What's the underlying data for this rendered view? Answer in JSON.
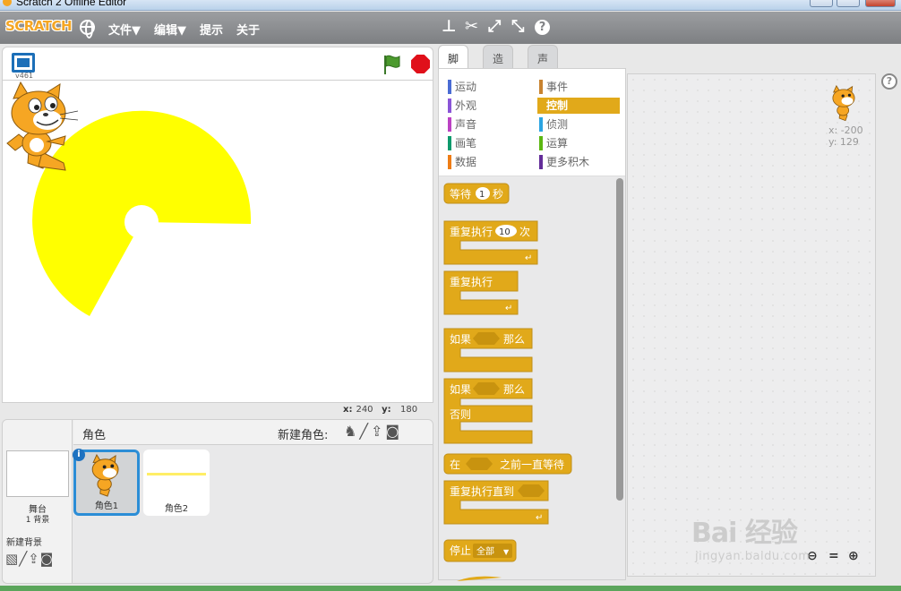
{
  "window": {
    "title": "Scratch 2 Offline Editor"
  },
  "menubar": {
    "logo": "SCRATCH",
    "file": "文件▼",
    "edit": "编辑▼",
    "tips": "提示",
    "about": "关于"
  },
  "stage": {
    "version": "v461",
    "x_label": "x:",
    "x_value": "240",
    "y_label": "y:",
    "y_value": "180"
  },
  "sprites": {
    "title": "角色",
    "new_sprite": "新建角色:",
    "items": [
      {
        "name": "角色1",
        "selected": true
      },
      {
        "name": "角色2",
        "selected": false
      }
    ]
  },
  "backdrop": {
    "label": "舞台",
    "count": "1 背景",
    "new_backdrop": "新建背景"
  },
  "tabs": [
    {
      "label": "脚本",
      "active": true
    },
    {
      "label": "造型",
      "active": false
    },
    {
      "label": "声音",
      "active": false
    }
  ],
  "categories": [
    {
      "label": "运动",
      "color": "#4a6cd4"
    },
    {
      "label": "事件",
      "color": "#c88330"
    },
    {
      "label": "外观",
      "color": "#8a55d7"
    },
    {
      "label": "控制",
      "color": "#e1a91a",
      "selected": true
    },
    {
      "label": "声音",
      "color": "#bb42c3"
    },
    {
      "label": "侦测",
      "color": "#2ca5e2"
    },
    {
      "label": "画笔",
      "color": "#0e9a6c"
    },
    {
      "label": "运算",
      "color": "#5cb712"
    },
    {
      "label": "数据",
      "color": "#ee7d16"
    },
    {
      "label": "更多积木",
      "color": "#632d99"
    }
  ],
  "blocks": {
    "wait": "等待",
    "wait_value": "1",
    "wait_unit": "秒",
    "repeat": "重复执行",
    "repeat_value": "10",
    "repeat_unit": "次",
    "forever": "重复执行",
    "if": "如果",
    "then": "那么",
    "else": "否则",
    "wait_until_pre": "在",
    "wait_until_post": "之前一直等待",
    "repeat_until": "重复执行直到",
    "stop": "停止",
    "stop_option": "全部"
  },
  "scripts": {
    "sprite_x": "x: -200",
    "sprite_y": "y: 129"
  },
  "watermark": {
    "brand": "Bai 经验",
    "url": "jingyan.baidu.com"
  },
  "colors": {
    "control_block": "#e1a91a",
    "pen_fill": "#ffff00",
    "accent_blue": "#1c6fb8"
  }
}
